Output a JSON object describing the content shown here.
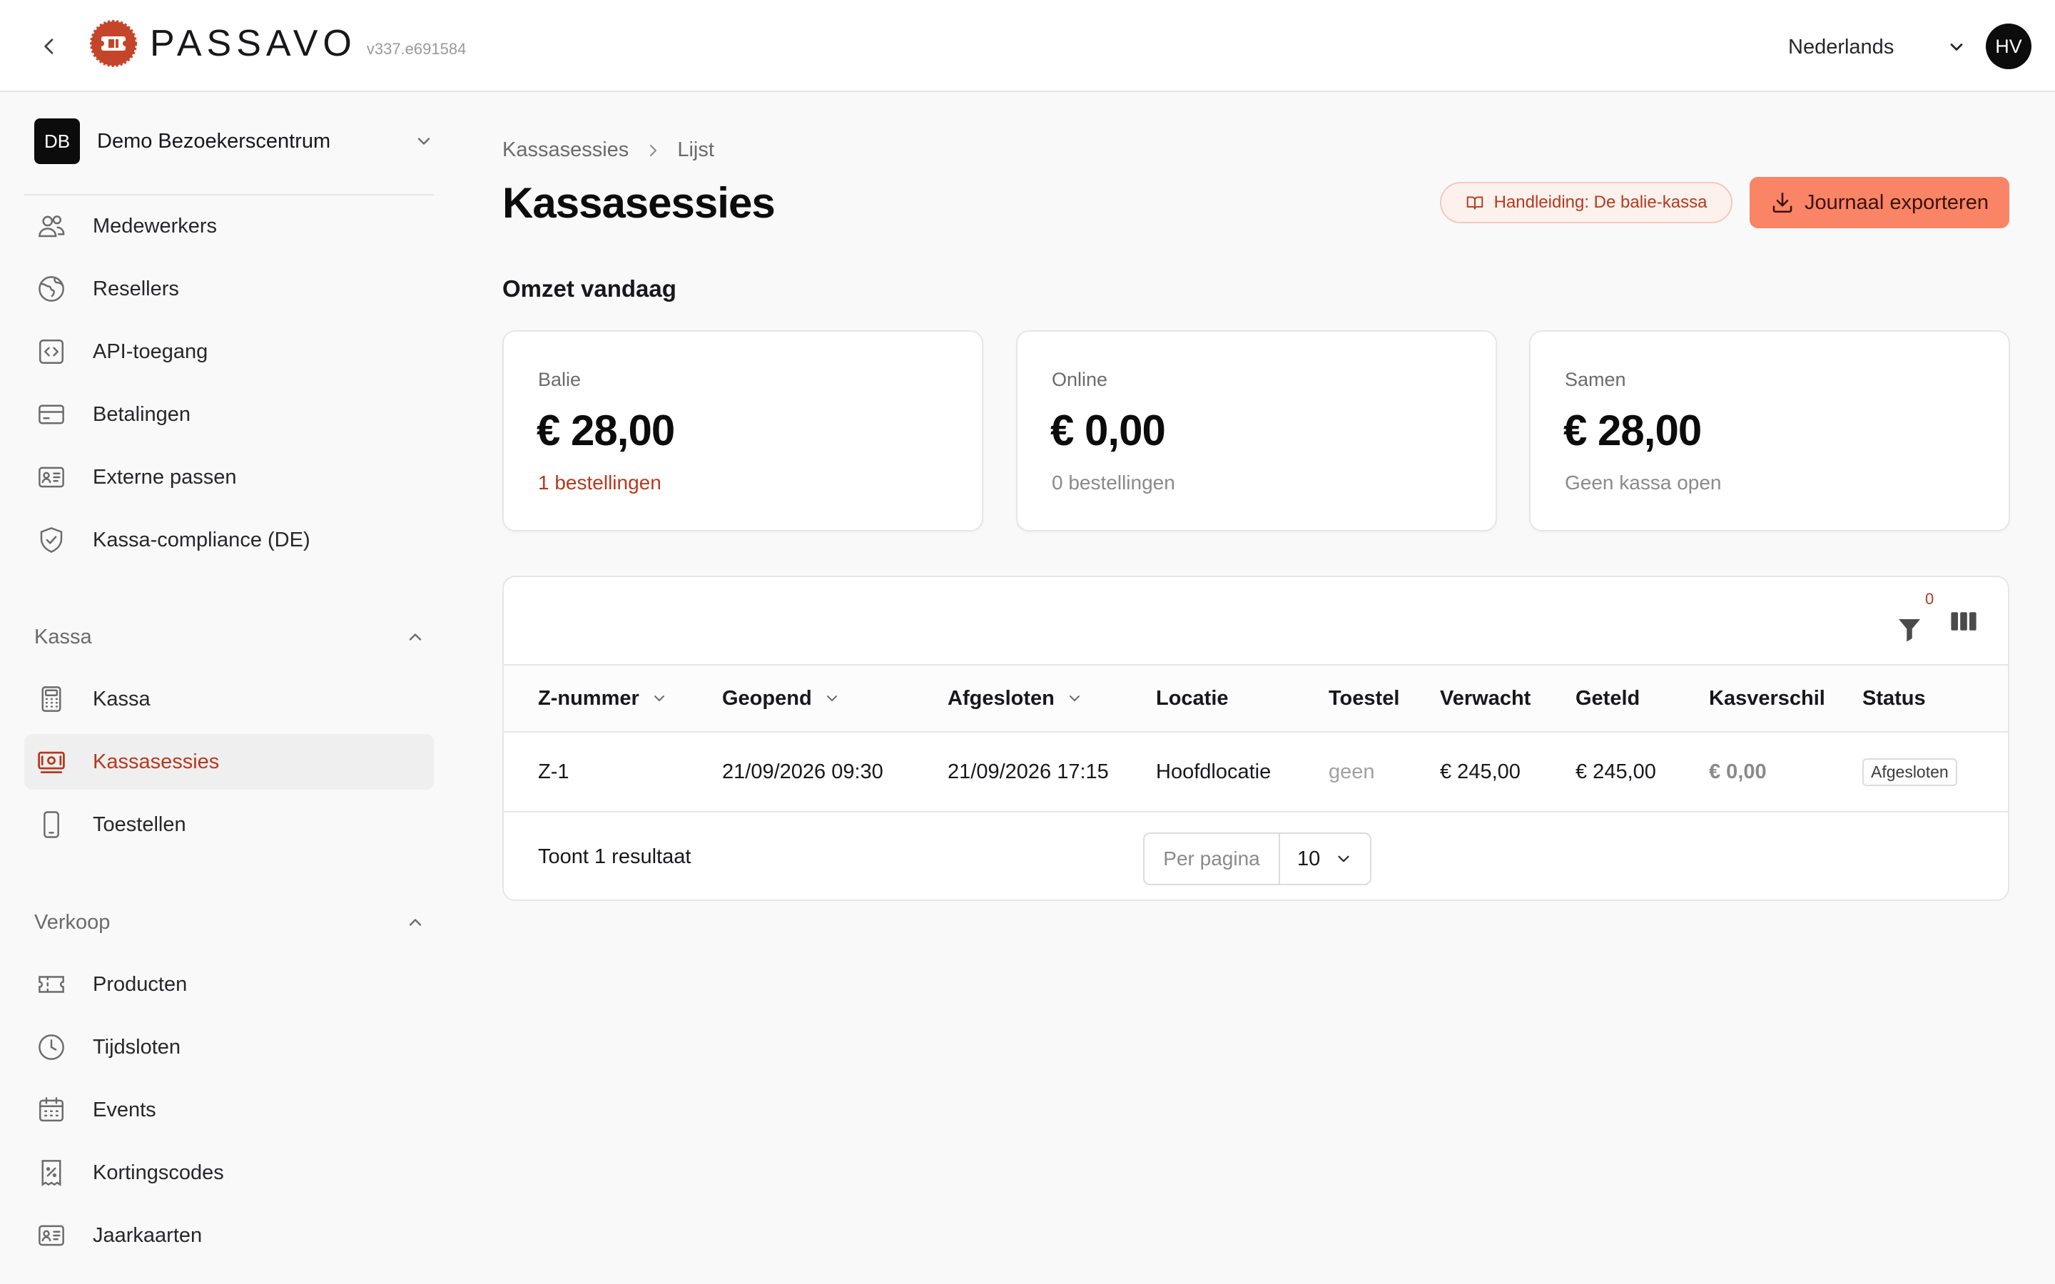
{
  "header": {
    "brand": "PASSAVO",
    "version": "v337.e691584",
    "language": "Nederlands",
    "user_initials": "HV"
  },
  "sidebar": {
    "org_initials": "DB",
    "org_name": "Demo Bezoekerscentrum",
    "top_items": [
      {
        "label": "Medewerkers",
        "icon": "users-icon"
      },
      {
        "label": "Resellers",
        "icon": "globe-icon"
      },
      {
        "label": "API-toegang",
        "icon": "code-icon"
      },
      {
        "label": "Betalingen",
        "icon": "credit-card-icon"
      },
      {
        "label": "Externe passen",
        "icon": "id-card-icon"
      },
      {
        "label": "Kassa-compliance (DE)",
        "icon": "shield-check-icon"
      }
    ],
    "sections": [
      {
        "label": "Kassa",
        "items": [
          {
            "label": "Kassa",
            "icon": "calculator-icon"
          },
          {
            "label": "Kassasessies",
            "icon": "cash-register-icon",
            "active": true
          },
          {
            "label": "Toestellen",
            "icon": "smartphone-icon"
          }
        ]
      },
      {
        "label": "Verkoop",
        "items": [
          {
            "label": "Producten",
            "icon": "ticket-icon"
          },
          {
            "label": "Tijdsloten",
            "icon": "clock-icon"
          },
          {
            "label": "Events",
            "icon": "calendar-icon"
          },
          {
            "label": "Kortingscodes",
            "icon": "percent-receipt-icon"
          },
          {
            "label": "Jaarkaarten",
            "icon": "id-card-icon"
          }
        ]
      }
    ]
  },
  "breadcrumb": [
    "Kassasessies",
    "Lijst"
  ],
  "page": {
    "title": "Kassasessies",
    "guide_button": "Handleiding: De balie-kassa",
    "export_button": "Journaal exporteren",
    "subtitle": "Omzet vandaag"
  },
  "cards": [
    {
      "label": "Balie",
      "value": "€ 28,00",
      "sub": "1 bestellingen"
    },
    {
      "label": "Online",
      "value": "€ 0,00",
      "sub": "0 bestellingen"
    },
    {
      "label": "Samen",
      "value": "€ 28,00",
      "sub": "Geen kassa open"
    }
  ],
  "table": {
    "filter_count": "0",
    "columns": [
      "Z-nummer",
      "Geopend",
      "Afgesloten",
      "Locatie",
      "Toestel",
      "Verwacht",
      "Geteld",
      "Kasverschil",
      "Status"
    ],
    "rows": [
      {
        "z_number": "Z-1",
        "opened": "21/09/2026 09:30",
        "closed": "21/09/2026 17:15",
        "location": "Hoofdlocatie",
        "device": "geen",
        "expected": "€ 245,00",
        "counted": "€ 245,00",
        "difference": "€ 0,00",
        "status": "Afgesloten"
      }
    ],
    "results_text": "Toont 1 resultaat",
    "per_page_label": "Per pagina",
    "per_page_value": "10"
  },
  "colors": {
    "accent": "#b5391f",
    "button": "#fa8466",
    "dark": "#0c0c0c"
  }
}
